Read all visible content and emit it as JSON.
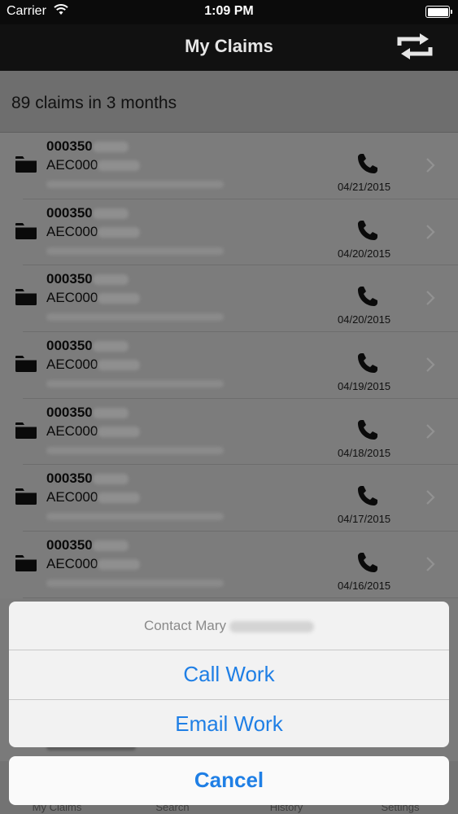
{
  "status_bar": {
    "carrier": "Carrier",
    "time": "1:09 PM"
  },
  "nav": {
    "title": "My Claims",
    "right_icon": "refresh-icon"
  },
  "summary": {
    "text": "89 claims in 3 months"
  },
  "claims": [
    {
      "claim_prefix": "000350",
      "account_prefix": "AEC000",
      "date": "04/21/2015"
    },
    {
      "claim_prefix": "000350",
      "account_prefix": "AEC000",
      "date": "04/20/2015"
    },
    {
      "claim_prefix": "000350",
      "account_prefix": "AEC000",
      "date": "04/20/2015"
    },
    {
      "claim_prefix": "000350",
      "account_prefix": "AEC000",
      "date": "04/19/2015"
    },
    {
      "claim_prefix": "000350",
      "account_prefix": "AEC000",
      "date": "04/18/2015"
    },
    {
      "claim_prefix": "000350",
      "account_prefix": "AEC000",
      "date": "04/17/2015"
    },
    {
      "claim_prefix": "000350",
      "account_prefix": "AEC000",
      "date": "04/16/2015"
    }
  ],
  "tab_bar": {
    "tabs": [
      "My Claims",
      "Search",
      "History",
      "Settings"
    ]
  },
  "action_sheet": {
    "title": "Contact Mary",
    "options": [
      "Call Work",
      "Email Work"
    ],
    "cancel": "Cancel"
  },
  "colors": {
    "accent": "#1f7fe5",
    "nav_background": "#111111"
  }
}
